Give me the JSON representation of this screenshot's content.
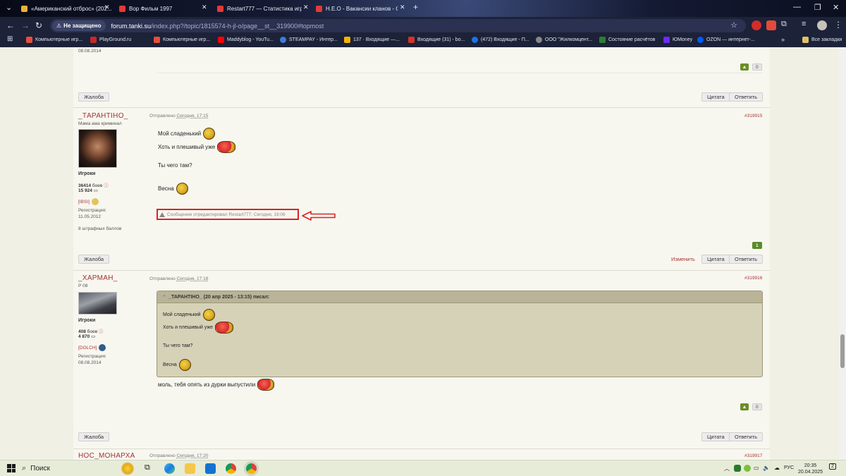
{
  "browser": {
    "tabs": [
      {
        "title": "«Американский отброс» (202...",
        "color": "#e8b23a"
      },
      {
        "title": "Вор Фильм 1997",
        "color": "#e53935"
      },
      {
        "title": "Restart777 — Статистика игро...",
        "color": "#e53935"
      },
      {
        "title": "Н.Е.О - Вакансии кланов - Ос...",
        "color": "#e53935"
      }
    ],
    "new_tab": "+",
    "secure_label": "Не защищено",
    "url_host": "forum.tanki.su",
    "url_path": "/index.php?/topic/1815574-h-jl-o/page__st__319900#topmost",
    "bookmarks": [
      {
        "label": "Компьютерные игр...",
        "color": "#e84d3a"
      },
      {
        "label": "PlayGround.ru",
        "color": "#c62828"
      },
      {
        "label": "Компьютерные игр...",
        "color": "#e84d3a"
      },
      {
        "label": "Maddyblog - YouTu...",
        "color": "#ff0000"
      },
      {
        "label": "STEAMPAY - Интер...",
        "color": "#3b7dd8"
      },
      {
        "label": "137 · Входящие —...",
        "color": "#f5b400"
      },
      {
        "label": "Входящие (31) - bo...",
        "color": "#d93025"
      },
      {
        "label": "(472) Входящие - П...",
        "color": "#1a73e8"
      },
      {
        "label": "ООО \"Жилкомцент...",
        "color": "#888888"
      },
      {
        "label": "Состояние расчётов",
        "color": "#2e7d32"
      },
      {
        "label": "ЮMoney",
        "color": "#6b2cf5"
      },
      {
        "label": "OZON — интернет-...",
        "color": "#005bff"
      }
    ],
    "all_bookmarks": "Все закладки"
  },
  "forum": {
    "top_post": {
      "reg_date": "08.08.2014",
      "rep_count": "0",
      "report_label": "Жалоба",
      "quote_label": "Цитата",
      "reply_label": "Ответить"
    },
    "post1": {
      "username": "_ТАРАНТІНО_",
      "subtitle": "Мама ама криминал",
      "group": "Игроки",
      "battles": "36414",
      "battles_label": "боев",
      "points": "15 924",
      "clan": "[IBSI]",
      "reg_label": "Регистрация:",
      "reg_date": "11.05.2012",
      "penalty": "8 штрафных баллов",
      "posted_prefix": "Отправлено",
      "posted_time": "Сегодня, 17:15",
      "post_number": "#319915",
      "lines": [
        "Мой сладенький",
        "Хоть и плешивый уже",
        "Ты чего там?",
        "Весна"
      ],
      "edited_note": "Сообщение отредактировал Restart777: Сегодня, 19:06",
      "rep_count": "1",
      "report_label": "Жалоба",
      "edit_label": "Изменить",
      "quote_label": "Цитата",
      "reply_label": "Ответить"
    },
    "post2": {
      "username": "_ХАРМАН_",
      "subtitle": "Р 08",
      "group": "Игроки",
      "battles": "408",
      "battles_label": "боев",
      "points": "4 870",
      "clan": "[DOLCH]",
      "reg_label": "Регистрация:",
      "reg_date": "08.08.2014",
      "posted_prefix": "Отправлено",
      "posted_time": "Сегодня, 17:18",
      "post_number": "#319916",
      "quote_header": "_ТАРАНТІНО_ (20 апр 2025 - 13:15) писал:",
      "quote_lines": [
        "Мой сладенький",
        "Хоть и плешивый уже",
        "Ты чего там?",
        "Весна"
      ],
      "reply_text": "моль, тебя опять из дурки выпустили",
      "rep_count": "0",
      "report_label": "Жалоба",
      "quote_label": "Цитата",
      "reply_label": "Ответить"
    },
    "post3": {
      "username": "НОС_МОНАРХА",
      "posted_prefix": "Отправлено",
      "posted_time": "Сегодня, 17:20",
      "post_number": "#319917"
    }
  },
  "taskbar": {
    "search_label": "Поиск",
    "lang": "РУС",
    "time": "20:35",
    "date": "20.04.2025",
    "notif_count": "2"
  }
}
